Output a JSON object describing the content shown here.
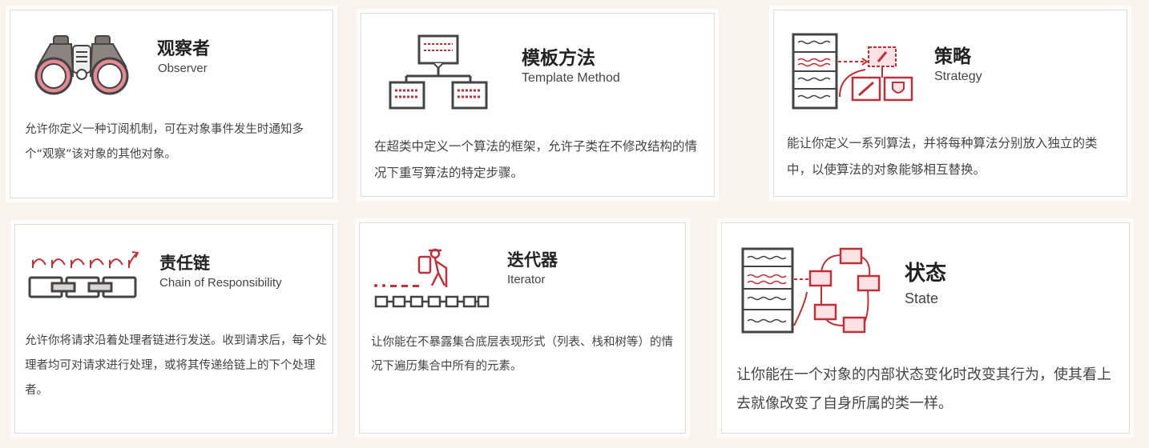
{
  "colors": {
    "background": "#faf4ef",
    "accent": "#c0303a",
    "dark": "#444444",
    "card": "#ffffff"
  },
  "cards": [
    {
      "title": "观察者",
      "subtitle": "Observer",
      "icon": "binoculars-icon",
      "description": "允许你定义一种订阅机制，可在对象事件发生时通知多个“观察”该对象的其他对象。"
    },
    {
      "title": "模板方法",
      "subtitle": "Template Method",
      "icon": "template-hierarchy-icon",
      "description": "在超类中定义一个算法的框架，允许子类在不修改结构的情况下重写算法的特定步骤。"
    },
    {
      "title": "策略",
      "subtitle": "Strategy",
      "icon": "strategy-icon",
      "description": "能让你定义一系列算法，并将每种算法分别放入独立的类中，以使算法的对象能够相互替换。"
    },
    {
      "title": "责任链",
      "subtitle": "Chain of Responsibility",
      "icon": "chain-icon",
      "description": "允许你将请求沿着处理者链进行发送。收到请求后，每个处理者均可对请求进行处理，或将其传递给链上的下个处理者。"
    },
    {
      "title": "迭代器",
      "subtitle": "Iterator",
      "icon": "hiker-iterator-icon",
      "description": "让你能在不暴露集合底层表现形式（列表、栈和树等）的情况下遍历集合中所有的元素。"
    },
    {
      "title": "状态",
      "subtitle": "State",
      "icon": "state-machine-icon",
      "description": "让你能在一个对象的内部状态变化时改变其行为，使其看上去就像改变了自身所属的类一样。"
    }
  ]
}
